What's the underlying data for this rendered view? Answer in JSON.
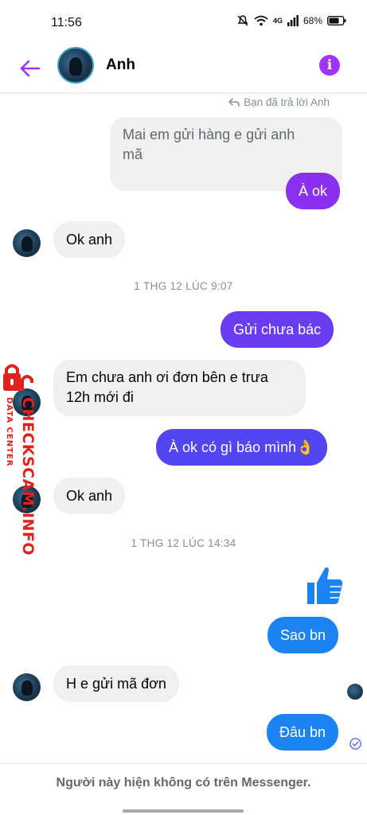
{
  "status_bar": {
    "time": "11:56",
    "battery": "68%",
    "network": "4G"
  },
  "header": {
    "contact_name": "Anh",
    "back_icon": "arrow-left-icon",
    "info_icon": "info-icon",
    "accent_color": "#a033ff"
  },
  "reply_note": "Bạn đã trả lời Anh",
  "messages": [
    {
      "sender": "me",
      "style": "replied-quote",
      "line1": "Mai em gửi hàng e gửi anh",
      "line2": "mã"
    },
    {
      "sender": "me",
      "text": "À ok"
    },
    {
      "sender": "Anh",
      "text": "Ok anh"
    },
    {
      "type": "timestamp",
      "text": "1 THG 12 LÚC 9:07"
    },
    {
      "sender": "me",
      "text": "Gửi chưa bác"
    },
    {
      "sender": "Anh",
      "line1": "Em chưa anh ơi đơn bên e trưa",
      "line2": "12h mới đi"
    },
    {
      "sender": "me",
      "text": "À ok có gì báo mình👌"
    },
    {
      "sender": "Anh",
      "text": "Ok anh"
    },
    {
      "type": "timestamp",
      "text": "1 THG 12 LÚC 14:34"
    },
    {
      "sender": "me",
      "type": "like",
      "icon": "thumbs-up-icon"
    },
    {
      "sender": "me",
      "text": "Sao bn"
    },
    {
      "sender": "Anh",
      "text": "H e gửi mã đơn"
    },
    {
      "sender": "me",
      "text": "Đâu bn"
    }
  ],
  "footer": {
    "notice": "Người này hiện không có trên Messenger."
  },
  "watermark": {
    "text": "CHECKSCAM.INFO",
    "sub": "DATA CENTER",
    "color": "#e0211c"
  },
  "colors": {
    "purple": "#8a30f0",
    "violet": "#6a3cf2",
    "indigo": "#5246f0",
    "blue": "#1c84f2",
    "incoming": "#f0f0f0"
  }
}
